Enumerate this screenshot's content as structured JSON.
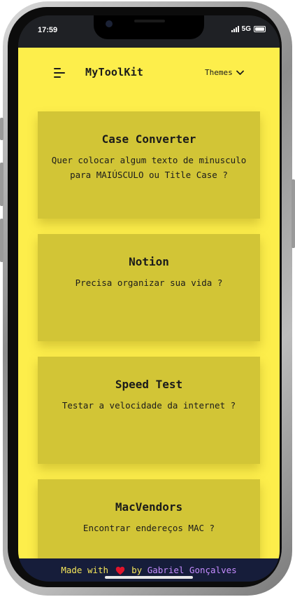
{
  "status_bar": {
    "time": "17:59",
    "network": "5G"
  },
  "header": {
    "brand": "MyToolKit",
    "themes_label": "Themes",
    "menu_icon": "menu-icon",
    "chevron_icon": "chevron-down-icon"
  },
  "cards": [
    {
      "title": "Case Converter",
      "description": "Quer colocar algum texto de minusculo para MAIÚSCULO ou Title Case ?"
    },
    {
      "title": "Notion",
      "description": "Precisa organizar sua vida ?"
    },
    {
      "title": "Speed Test",
      "description": "Testar a velocidade da internet ?"
    },
    {
      "title": "MacVendors",
      "description": "Encontrar endereços MAC ?"
    }
  ],
  "footer": {
    "made_with": "Made with",
    "by": "by",
    "author": "Gabriel Gonçalves",
    "heart_icon": "heart-icon"
  },
  "colors": {
    "background": "#fdee4b",
    "card": "#d2c536",
    "footer": "#161d3a",
    "footer_text": "#f4e55a",
    "author": "#c58cff",
    "heart": "#e0142b"
  }
}
